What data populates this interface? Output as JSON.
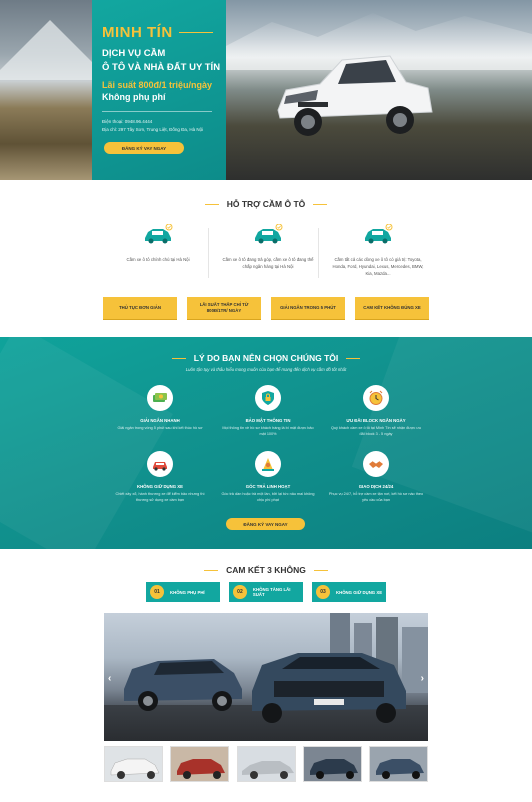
{
  "hero": {
    "brand": "MINH TÍN",
    "headline_1": "DỊCH VỤ CẦM",
    "headline_2": "Ô TÔ VÀ NHÀ ĐẤT UY TÍN",
    "rate": "Lãi suất 800đ/1 triệu/ngày",
    "free": "Không phụ phí",
    "phone": "Điện thoại: 0948.96.4444",
    "address": "Địa chỉ: 297 Tây Sơn, Trung Liệt, Đống Đa, Hà Nội",
    "cta": "ĐĂNG KÝ VAY NGAY"
  },
  "support": {
    "title": "HỖ TRỢ CẦM Ô TÔ",
    "items": [
      {
        "text": "Cầm xe ô tô chính chủ tại Hà Nội"
      },
      {
        "text": "Cầm xe ô tô đang trả góp, cầm xe ô tô đang thế chấp ngân hàng tại Hà Nội"
      },
      {
        "text": "Cầm tất cả các dòng xe ô tô có giá trị: Toyota, Honda, Ford, Hyundai, Lexus, Mercedes, BMW, Kia, Mazda..."
      }
    ],
    "buttons": [
      "THỦ TỤC ĐƠN GIẢN",
      "LÃI SUẤT THẤP CHỈ TỪ 800Đ/1TR/ NGÀY",
      "GIẢI NGÂN TRONG 5 PHÚT",
      "CAM KẾT KHÔNG ĐÚNG XE"
    ]
  },
  "reasons": {
    "title": "LÝ DO BẠN NÊN CHỌN CHÚNG TÔI",
    "subtitle": "Luôn tận tụy và thấu hiểu mong muốn của bạn để mang đến dịch vụ cầm đồ tốt nhất",
    "items": [
      {
        "title": "GIẢI NGÂN NHANH",
        "desc": "Giải ngân trong vòng 5 phút sau khi kết thúc hồ sơ"
      },
      {
        "title": "BẢO MẬT THÔNG TIN",
        "desc": "Mọi thông tin về hồ sơ khách hàng là bí mật được bảo mật 100%"
      },
      {
        "title": "ƯU ĐÃI BLOCK NGẮN NGÀY",
        "desc": "Quý khách cầm xe ô tô tại Minh Tín sẽ nhận được ưu đãi block 3 - 5 ngày"
      },
      {
        "title": "KHÔNG GIỮ DỤNG XE",
        "desc": "Chiết xây xổ, hành thương xe để kiểm bảo nhưng thì thương sử dụng xe cầm bạn"
      },
      {
        "title": "GÓC TRẢ LINH HOẠT",
        "desc": "Góc trả dần hoặc trả một lần, bởi lại tức nâu mai không chịu phí phạt"
      },
      {
        "title": "GIAO DỊCH 24/24",
        "desc": "Phục vụ 24/7, hỗ trợ cầm xe tận nơi, kết hồ sơ nào theo yêu cầu của bạn"
      }
    ],
    "cta": "ĐĂNG KÝ VAY NGAY"
  },
  "commit": {
    "title": "CAM KẾT 3 KHÔNG",
    "items": [
      {
        "num": "01",
        "label": "KHÔNG PHỤ PHÍ"
      },
      {
        "num": "02",
        "label": "KHÔNG TĂNG LÃI SUẤT"
      },
      {
        "num": "03",
        "label": "KHÔNG GIỮ DỤNG XE"
      }
    ],
    "arrow_prev": "‹",
    "arrow_next": "›"
  },
  "colors": {
    "teal": "#12a7a0",
    "yellow": "#f6c23a"
  }
}
